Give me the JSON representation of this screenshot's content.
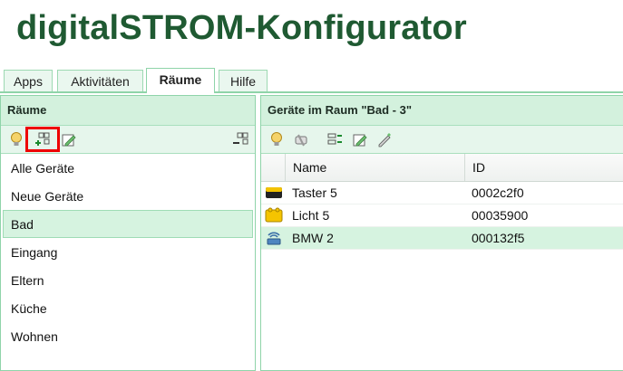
{
  "app": {
    "title": "digitalSTROM-Konfigurator"
  },
  "tabs": [
    {
      "label": "Apps",
      "active": false
    },
    {
      "label": "Aktivitäten",
      "active": false
    },
    {
      "label": "Räume",
      "active": true
    },
    {
      "label": "Hilfe",
      "active": false
    }
  ],
  "rooms_panel": {
    "title": "Räume",
    "toolbar_icons": [
      "lightbulb-icon",
      "add-room-icon",
      "edit-room-icon",
      "remove-room-icon"
    ],
    "items": [
      "Alle Geräte",
      "Neue Geräte",
      "Bad",
      "Eingang",
      "Eltern",
      "Küche",
      "Wohnen"
    ],
    "selected": "Bad"
  },
  "devices_panel": {
    "title": "Geräte im Raum \"Bad - 3\"",
    "toolbar_icons": [
      "lightbulb-icon",
      "configure-icon",
      "device-properties-icon",
      "edit-icon",
      "pen-icon"
    ],
    "columns": [
      "Name",
      "ID"
    ],
    "rows": [
      {
        "icon": "black-device-icon",
        "name": "Taster 5",
        "id": "0002c2f0"
      },
      {
        "icon": "yellow-device-icon",
        "name": "Licht 5",
        "id": "00035900"
      },
      {
        "icon": "blue-wireless-device-icon",
        "name": "BMW 2",
        "id": "000132f5"
      }
    ],
    "selected": "BMW 2"
  },
  "colors": {
    "accent": "#1f5a32",
    "panel_header": "#d3f1dd",
    "border": "#8fd4a9",
    "annotation": "#ee0000"
  }
}
